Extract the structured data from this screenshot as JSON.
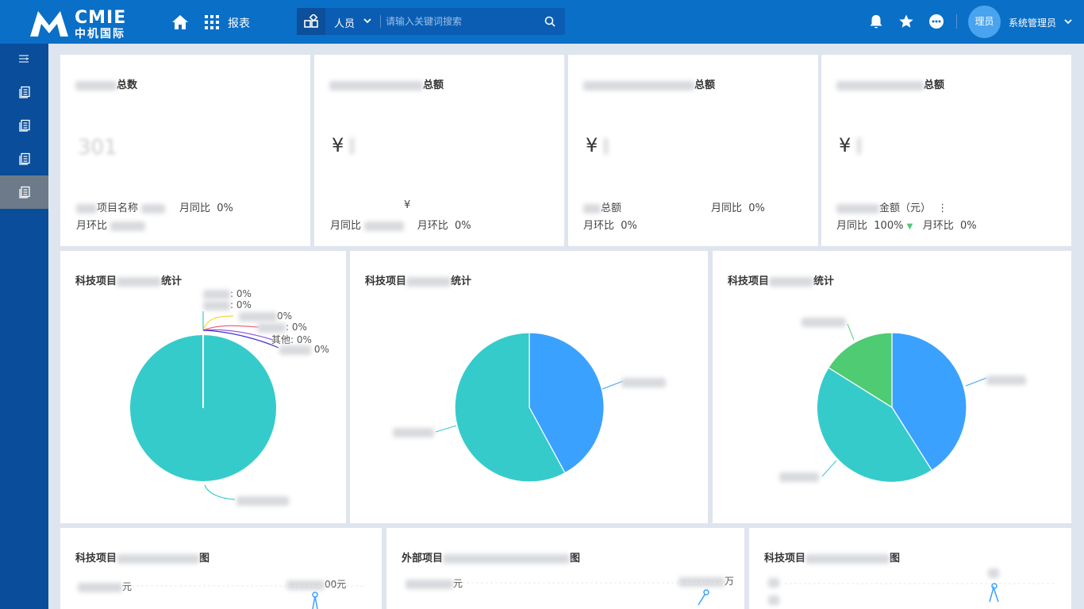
{
  "header": {
    "logo_text": "CMIE",
    "logo_cn": "中机国际",
    "report_label": "报表",
    "search_category": "人员",
    "search_placeholder": "请输入关键词搜索",
    "avatar_text": "理员",
    "user_name": "系统管理员"
  },
  "icons": {
    "home": "home-icon",
    "apps": "grid-icon",
    "bell": "bell-icon",
    "star": "star-icon",
    "more": "more-icon",
    "search": "search-icon"
  },
  "colors": {
    "primary": "#0a6fc7",
    "teal": "#36cbcb",
    "blue": "#3ba1ff",
    "green": "#4ecb73",
    "up": "#4ecb73"
  },
  "stat_cards": [
    {
      "title": "总数",
      "value": "301",
      "r1a": "项目名称",
      "r1b": "月同比",
      "r1c": "0%",
      "r2a": "月环比"
    },
    {
      "title": "总额",
      "yen": "¥",
      "r1a": "¥",
      "r2a": "月同比",
      "r2b": "月环比",
      "r2c": "0%"
    },
    {
      "title": "总额",
      "yen": "¥",
      "r1a": "总额",
      "r1b": "月同比",
      "r1c": "0%",
      "r2a": "月环比",
      "r2b": "0%"
    },
    {
      "title": "总额",
      "yen": "¥",
      "r1a": "金额（元）",
      "r1more": "⋮",
      "r2a": "月同比",
      "r2b": "100%",
      "r2c": "月环比",
      "r2d": "0%"
    }
  ],
  "pie_cards": [
    {
      "title": "科技项目",
      "title_suffix": "统计",
      "labels": [
        ": 0%",
        ": 0%",
        "0%",
        ": 0%",
        "其他: 0%",
        "0%"
      ]
    },
    {
      "title": "科技项目",
      "title_suffix": "统计"
    },
    {
      "title": "科技项目",
      "title_suffix": "统计"
    }
  ],
  "bottom_cards": [
    {
      "title": "科技项目",
      "title_suffix": "图",
      "ylab": "元",
      "ylab2": "00元"
    },
    {
      "title": "外部项目",
      "title_suffix": "图",
      "ylab": "元",
      "ylab2": "万"
    },
    {
      "title": "科技项目",
      "title_suffix": "图",
      "ylab": "",
      "ylab2": ""
    }
  ],
  "chart_data": [
    {
      "type": "pie",
      "values": [
        100,
        0,
        0,
        0,
        0,
        0
      ],
      "labels": [
        "",
        "",
        "",
        "",
        "其他",
        ""
      ]
    },
    {
      "type": "pie",
      "values": [
        42,
        58
      ]
    },
    {
      "type": "pie",
      "values": [
        40,
        44,
        16
      ]
    }
  ]
}
